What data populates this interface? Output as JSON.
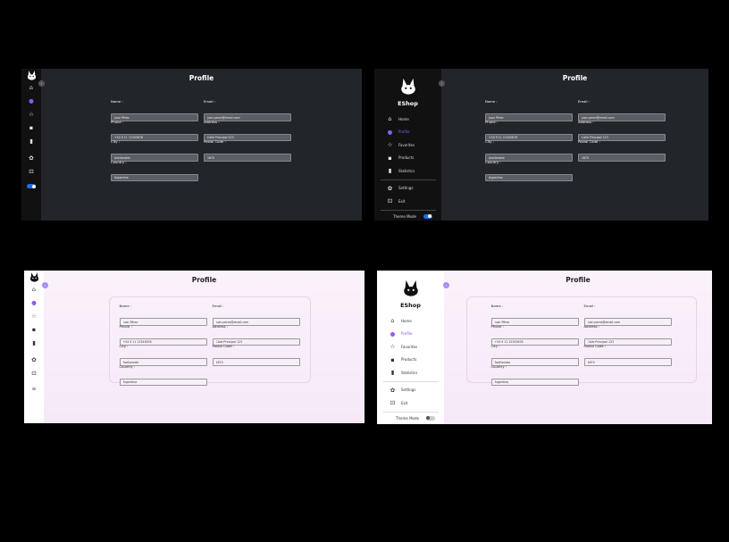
{
  "brand": "EShop",
  "page_title": "Profile",
  "nav": [
    {
      "label": "Home",
      "icon": "home-icon",
      "glyph": "⌂"
    },
    {
      "label": "Profile",
      "icon": "user-icon",
      "glyph": "●"
    },
    {
      "label": "Favorites",
      "icon": "star-icon",
      "glyph": "☆"
    },
    {
      "label": "Products",
      "icon": "grid-icon",
      "glyph": "▪"
    },
    {
      "label": "Statistics",
      "icon": "bar-chart-icon",
      "glyph": "▮"
    }
  ],
  "nav_secondary": [
    {
      "label": "Settings",
      "icon": "gear-icon",
      "glyph": "✿"
    },
    {
      "label": "Exit",
      "icon": "exit-icon",
      "glyph": "⊡"
    }
  ],
  "theme_mode_label": "Theme Mode",
  "form": {
    "name_label": "Name :",
    "name_value": "Juan Pérez",
    "email_label": "Email :",
    "email_value": "juan.perez@email.com",
    "phone_label": "Phone :",
    "phone_value": "+54 9 11 12345678",
    "address_label": "Address :",
    "address_value": "Calle Principal 123",
    "city_label": "City :",
    "city_value": "Avellaneda",
    "postal_label": "Postal Code :",
    "postal_value": "1870",
    "country_label": "Country :",
    "country_value": "Argentina"
  },
  "colors": {
    "accent": "#8b5cf6",
    "dark_bg": "#22252a",
    "dark_sidebar": "#111111",
    "light_bg": "#f6e8f8",
    "toggle_on": "#1e6ee8"
  }
}
